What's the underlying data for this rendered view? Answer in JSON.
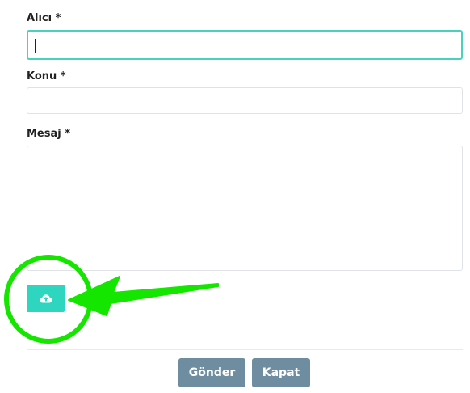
{
  "form": {
    "recipient_label": "Alıcı *",
    "recipient_value": "",
    "subject_label": "Konu *",
    "subject_value": "",
    "message_label": "Mesaj *",
    "message_value": ""
  },
  "upload": {
    "icon": "cloud-upload-icon"
  },
  "footer": {
    "send_label": "Gönder",
    "close_label": "Kapat"
  },
  "colors": {
    "focus_border": "#48d1bd",
    "upload_button": "#2fd6bf",
    "footer_button": "#6f8da1",
    "annotation": "#14e600"
  },
  "annotation": {
    "circle_icon": "highlight-circle",
    "arrow_icon": "arrow-left-icon"
  }
}
